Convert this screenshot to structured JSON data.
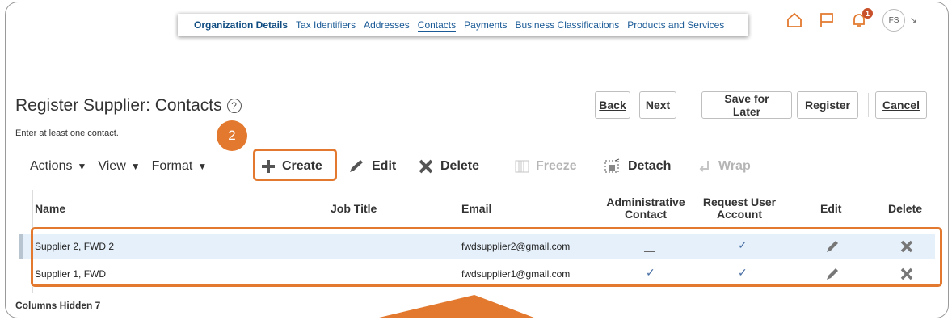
{
  "train": {
    "items": [
      "Organization Details",
      "Tax Identifiers",
      "Addresses",
      "Contacts",
      "Payments",
      "Business Classifications",
      "Products and Services"
    ]
  },
  "header": {
    "avatar_initials": "FS",
    "notification_count": "1"
  },
  "page": {
    "title": "Register Supplier: Contacts",
    "instructions": "Enter at least one contact."
  },
  "buttons": {
    "back": "Back",
    "next": "Next",
    "save_for_later": "Save for Later",
    "register": "Register",
    "cancel": "Cancel"
  },
  "step_badge": "2",
  "toolbar": {
    "actions": "Actions",
    "view": "View",
    "format": "Format",
    "create": "Create",
    "edit": "Edit",
    "delete": "Delete",
    "freeze": "Freeze",
    "detach": "Detach",
    "wrap": "Wrap"
  },
  "table": {
    "columns": [
      "Name",
      "Job Title",
      "Email",
      "Administrative Contact",
      "Request User Account",
      "Edit",
      "Delete"
    ],
    "rows": [
      {
        "name": "Supplier 2, FWD 2",
        "job_title": "",
        "email": "fwdsupplier2@gmail.com",
        "administrative_contact": false,
        "request_user_account": true
      },
      {
        "name": "Supplier 1, FWD",
        "job_title": "",
        "email": "fwdsupplier1@gmail.com",
        "administrative_contact": true,
        "request_user_account": true
      }
    ]
  },
  "columns_hidden": "Columns Hidden  7",
  "colors": {
    "accent_orange": "#e2792f",
    "link_blue": "#1a5a96",
    "selected_row": "#e5f0fb"
  }
}
